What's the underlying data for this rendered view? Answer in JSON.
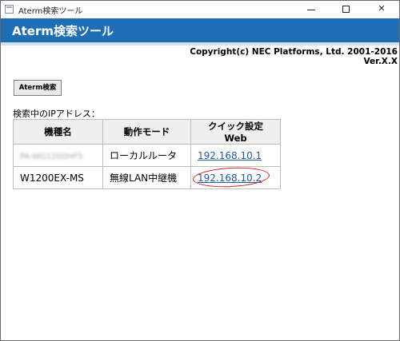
{
  "window": {
    "title": "Aterm検索ツール",
    "minimize_glyph": "",
    "close_glyph": "✕"
  },
  "header": {
    "title": "Aterm検索ツール",
    "copyright": "Copyright(c) NEC Platforms, Ltd. 2001-2016",
    "version": "Ver.X.X"
  },
  "toolbar": {
    "search_label": "Aterm検索"
  },
  "results": {
    "label": "検索中のIPアドレス：",
    "columns": [
      "機種名",
      "動作モード",
      "クイック設定Web"
    ],
    "rows": [
      {
        "model": "PA-WG1200HP3",
        "mode": "ローカルルータ",
        "ip": "192.168.10.1"
      },
      {
        "model": "W1200EX-MS",
        "mode": "無線LAN中継機",
        "ip": "192.168.10.2"
      }
    ]
  },
  "colors": {
    "header_bg": "#1f6db3",
    "link": "#1e5aa8",
    "highlight_circle": "#d81e1e"
  }
}
